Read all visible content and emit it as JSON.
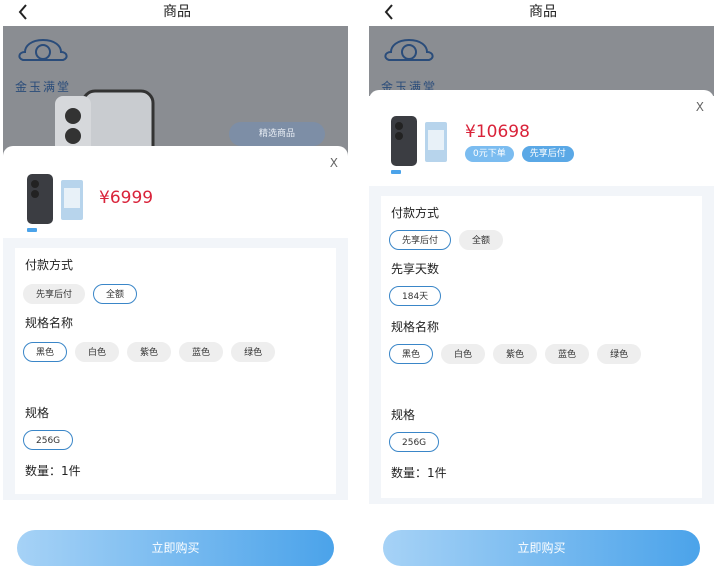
{
  "nav": {
    "title": "商品"
  },
  "bg_logo_text": "金玉满堂",
  "bg_badge": "精选商品",
  "left": {
    "price": "¥6999",
    "payment_title": "付款方式",
    "payment_options": [
      "先享后付",
      "全额"
    ],
    "spec_name_title": "规格名称",
    "colors": [
      "黑色",
      "白色",
      "紫色",
      "蓝色",
      "绿色"
    ],
    "spec_title": "规格",
    "storage": "256G",
    "quantity": "数量：1件",
    "buy_label": "立即购买"
  },
  "right": {
    "price": "¥10698",
    "tags": [
      "0元下单",
      "先享后付"
    ],
    "payment_title": "付款方式",
    "payment_options": [
      "先享后付",
      "全额"
    ],
    "days_title": "先享天数",
    "days": "184天",
    "spec_name_title": "规格名称",
    "colors": [
      "黑色",
      "白色",
      "紫色",
      "蓝色",
      "绿色"
    ],
    "spec_title": "规格",
    "storage": "256G",
    "quantity": "数量：1件",
    "buy_label": "立即购买"
  },
  "close_label": "X",
  "colors_ui": {
    "price": "#d9233a",
    "accent": "#3a86c8",
    "button_from": "#a6d2f6",
    "button_to": "#4ba3ea"
  }
}
